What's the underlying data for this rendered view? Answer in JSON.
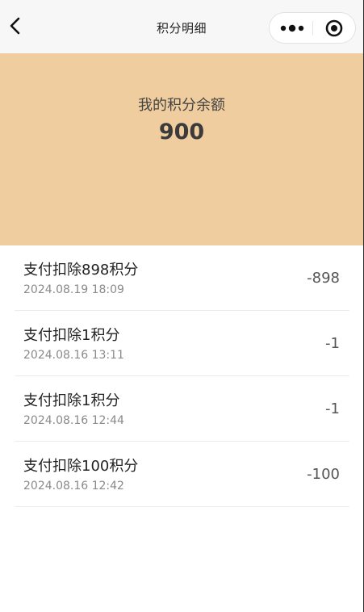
{
  "navbar": {
    "title": "积分明细",
    "back_icon": "chevron-left-icon",
    "more_icon": "more-dots-icon",
    "close_icon": "target-icon"
  },
  "balance": {
    "label": "我的积分余额",
    "value": "900"
  },
  "records": [
    {
      "title": "支付扣除898积分",
      "time": "2024.08.19 18:09",
      "amount": "-898"
    },
    {
      "title": "支付扣除1积分",
      "time": "2024.08.16 13:11",
      "amount": "-1"
    },
    {
      "title": "支付扣除1积分",
      "time": "2024.08.16 12:44",
      "amount": "-1"
    },
    {
      "title": "支付扣除100积分",
      "time": "2024.08.16 12:42",
      "amount": "-100"
    }
  ],
  "colors": {
    "banner": "#f0cd9e",
    "navbar": "#f7f7f7"
  }
}
